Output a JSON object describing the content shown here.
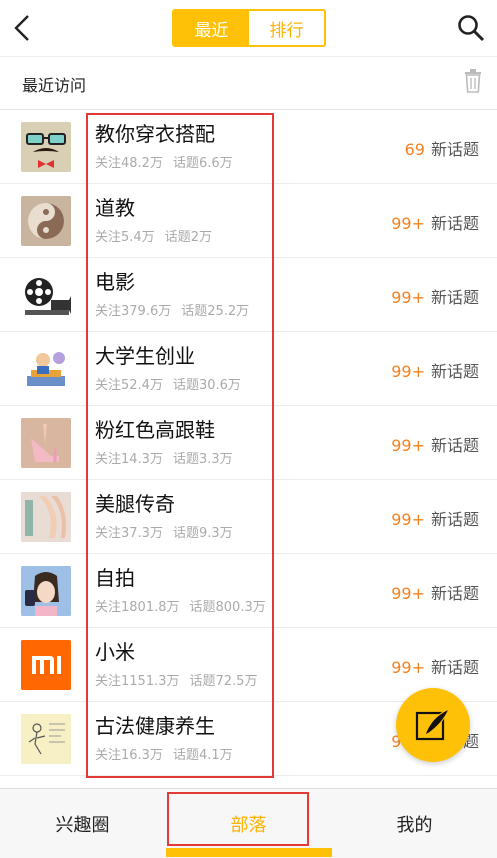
{
  "header": {
    "tabs": [
      {
        "label": "最近",
        "active": true
      },
      {
        "label": "排行",
        "active": false
      }
    ],
    "back_icon": "chevron-left-icon",
    "search_icon": "search-icon"
  },
  "recent_section": {
    "title": "最近访问",
    "clear_icon": "trash-icon"
  },
  "items": [
    {
      "name": "教你穿衣搭配",
      "followers": "关注48.2万",
      "topics": "话题6.6万",
      "new_count": "69",
      "new_label": "新话题"
    },
    {
      "name": "道教",
      "followers": "关注5.4万",
      "topics": "话题2万",
      "new_count": "99+",
      "new_label": "新话题"
    },
    {
      "name": "电影",
      "followers": "关注379.6万",
      "topics": "话题25.2万",
      "new_count": "99+",
      "new_label": "新话题"
    },
    {
      "name": "大学生创业",
      "followers": "关注52.4万",
      "topics": "话题30.6万",
      "new_count": "99+",
      "new_label": "新话题"
    },
    {
      "name": "粉红色高跟鞋",
      "followers": "关注14.3万",
      "topics": "话题3.3万",
      "new_count": "99+",
      "new_label": "新话题"
    },
    {
      "name": "美腿传奇",
      "followers": "关注37.3万",
      "topics": "话题9.3万",
      "new_count": "99+",
      "new_label": "新话题"
    },
    {
      "name": "自拍",
      "followers": "关注1801.8万",
      "topics": "话题800.3万",
      "new_count": "99+",
      "new_label": "新话题"
    },
    {
      "name": "小米",
      "followers": "关注1151.3万",
      "topics": "话题72.5万",
      "new_count": "99+",
      "new_label": "新话题"
    },
    {
      "name": "古法健康养生",
      "followers": "关注16.3万",
      "topics": "话题4.1万",
      "new_count": "99+",
      "new_label": "新话题"
    }
  ],
  "fab": {
    "icon": "compose-feather-icon"
  },
  "bottom_nav": [
    {
      "label": "兴趣圈",
      "active": false
    },
    {
      "label": "部落",
      "active": true
    },
    {
      "label": "我的",
      "active": false
    }
  ],
  "colors": {
    "accent": "#FFC107",
    "count": "#F58220",
    "highlight_box": "#E53935"
  }
}
